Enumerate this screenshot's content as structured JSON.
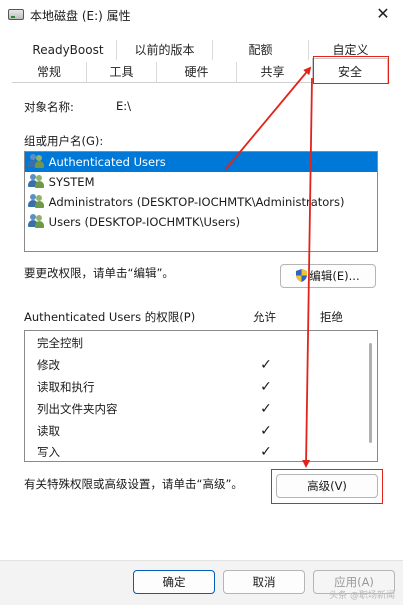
{
  "window": {
    "title": "本地磁盘 (E:) 属性",
    "close_icon": "close-icon"
  },
  "tabs": {
    "row1": [
      "ReadyBoost",
      "以前的版本",
      "配额",
      "自定义"
    ],
    "row2": [
      "常规",
      "工具",
      "硬件",
      "共享",
      "安全"
    ],
    "active": "安全"
  },
  "object": {
    "label": "对象名称:",
    "value": "E:\\"
  },
  "groups": {
    "label": "组或用户名(G):",
    "items": [
      "Authenticated Users",
      "SYSTEM",
      "Administrators (DESKTOP-IOCHMTK\\Administrators)",
      "Users (DESKTOP-IOCHMTK\\Users)"
    ],
    "selected_index": 0
  },
  "edit": {
    "hint": "要更改权限，请单击“编辑”。",
    "button": "编辑(E)..."
  },
  "permissions": {
    "header": "Authenticated Users 的权限(P)",
    "allow": "允许",
    "deny": "拒绝",
    "rows": [
      {
        "name": "完全控制",
        "allow": ""
      },
      {
        "name": "修改",
        "allow": "✓"
      },
      {
        "name": "读取和执行",
        "allow": "✓"
      },
      {
        "name": "列出文件夹内容",
        "allow": "✓"
      },
      {
        "name": "读取",
        "allow": "✓"
      },
      {
        "name": "写入",
        "allow": "✓"
      }
    ]
  },
  "advanced": {
    "hint": "有关特殊权限或高级设置，请单击“高级”。",
    "button": "高级(V)"
  },
  "footer": {
    "ok": "确定",
    "cancel": "取消",
    "apply": "应用(A)",
    "watermark": "头条 @职场新闻"
  },
  "colors": {
    "accent": "#0078d7",
    "annotation": "#e2231a"
  }
}
